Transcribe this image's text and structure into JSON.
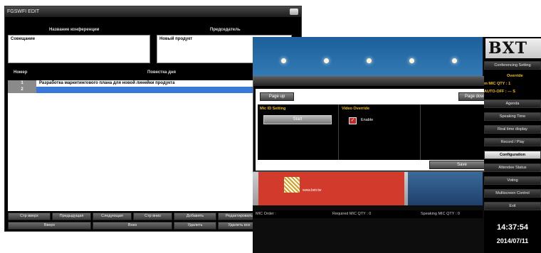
{
  "edit_window": {
    "title": "FGSWFI EDIT",
    "conference_name_header": "Название конференции",
    "presenter_header": "Председатель",
    "conference_name_value": "Совещание",
    "presenter_value": "Новый продукт",
    "number_header": "Номер",
    "agenda_header": "Повестка дня",
    "rows": [
      {
        "num": "1",
        "text": "Разработка маркетингового плана для новой линейки продукта"
      },
      {
        "num": "2",
        "text": ""
      }
    ],
    "buttons_row1": [
      "Стр вверх",
      "Предыдущая",
      "Следующая",
      "Стр вниз",
      "Добавить",
      "Редактировать"
    ],
    "buttons_row2": [
      "Вверх",
      "Вниз",
      "Удалить",
      "Удалить все"
    ]
  },
  "conference": {
    "banner_url": "www.bxtr.tw",
    "config_dialog": {
      "close_glyph": "✕",
      "page_up": "Page up",
      "page_down": "Page down",
      "mic_id_setting": "Mic ID Setting",
      "start": "Start",
      "video_override": "Video Override",
      "enable_check": "✓",
      "enable": "Enable",
      "save": "Save"
    },
    "status": {
      "mic_order": "MIC Order :",
      "required_qty": "Required MIC QTY :  0",
      "speaking_qty": "Speaking MIC QTY :  0"
    },
    "sidebar": {
      "logo": "BXT",
      "top_button": "Conferencing Setting",
      "override": "Override",
      "mic_qty": "m MIC QTY : 1",
      "auto_off": "AUTO-OFF : --- S",
      "menu": [
        "Agenda",
        "Speaking Time",
        "Real time display",
        "Record / Play",
        "Configuration",
        "Attendee Status",
        "Voting",
        "Multiscreen Control",
        "Exit"
      ],
      "active": "Configuration",
      "time": "14:37:54",
      "date": "2014/07/11"
    }
  },
  "colors": {
    "accent_yellow": "#f0c000",
    "selection_blue": "#3a78d8",
    "close_red": "#c43030"
  }
}
